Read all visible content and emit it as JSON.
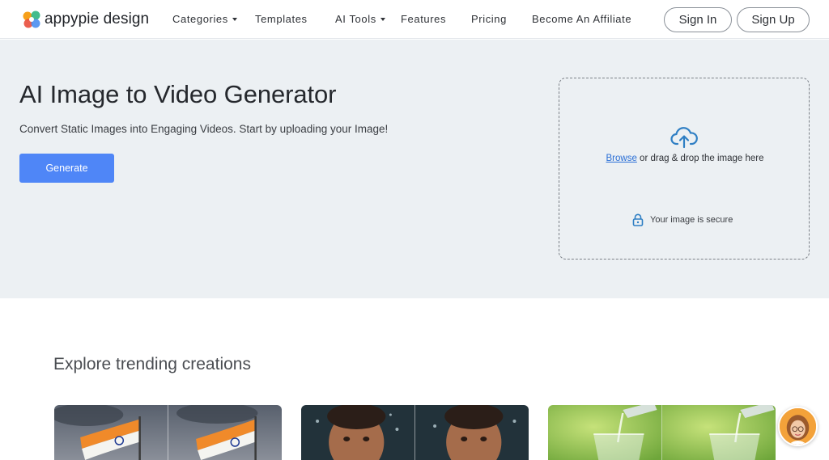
{
  "header": {
    "logo_text": "appypie design",
    "nav": [
      {
        "label": "Categories",
        "has_dropdown": true
      },
      {
        "label": "Templates",
        "has_dropdown": false
      },
      {
        "label": "AI Tools",
        "has_dropdown": true
      },
      {
        "label": "Features",
        "has_dropdown": false
      },
      {
        "label": "Pricing",
        "has_dropdown": false
      },
      {
        "label": "Become An Affiliate",
        "has_dropdown": false
      }
    ],
    "sign_in_label": "Sign In",
    "sign_up_label": "Sign Up"
  },
  "hero": {
    "title": "AI Image to Video Generator",
    "subtitle": "Convert Static Images into Engaging Videos. Start by uploading your Image!",
    "generate_label": "Generate",
    "upload": {
      "browse_label": "Browse",
      "drag_text": " or drag & drop the image here",
      "secure_text": "Your image is secure",
      "icon": "cloud-upload-icon"
    }
  },
  "explore": {
    "title": "Explore trending creations",
    "cards": [
      {
        "name": "trending-card-flag",
        "subject": "flag"
      },
      {
        "name": "trending-card-child",
        "subject": "child"
      },
      {
        "name": "trending-card-water",
        "subject": "water"
      }
    ]
  },
  "colors": {
    "accent": "#4f86f7",
    "hero_bg": "#ecf0f3",
    "link": "#2a6fd6",
    "icon_blue": "#2f7fc4"
  }
}
